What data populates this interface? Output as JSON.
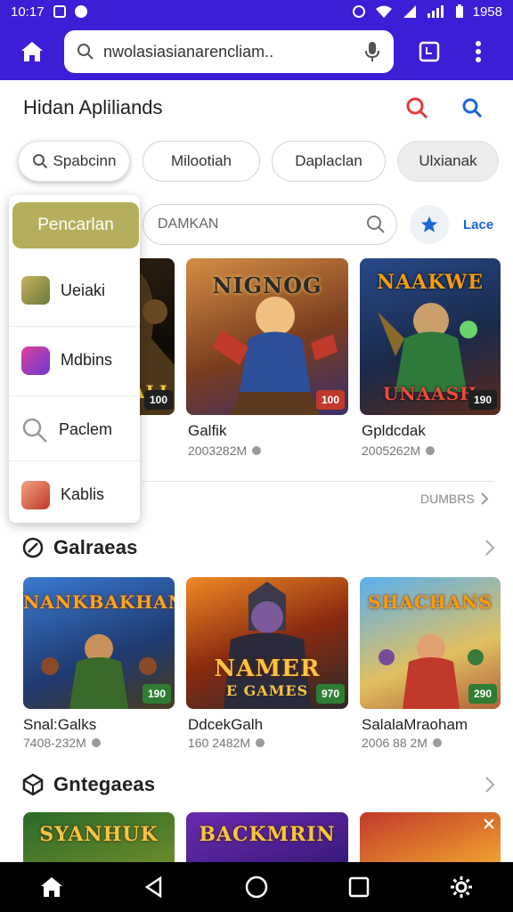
{
  "status_bar": {
    "time": "10:17",
    "battery": "1958"
  },
  "browser": {
    "url": "nwolasiasianarencliam.."
  },
  "header": {
    "title": "Hidan Apliliands"
  },
  "chips": [
    {
      "label": "Spabcinn"
    },
    {
      "label": "Milootiah"
    },
    {
      "label": "Daplaclan"
    },
    {
      "label": "Ulxianak"
    }
  ],
  "search": {
    "placeholder": "DAMKAN",
    "side_label": "Lace"
  },
  "dropdown": {
    "primary": "Pencarlan",
    "items": [
      {
        "label": "Ueiaki"
      },
      {
        "label": "Mdbins"
      },
      {
        "label": "Paclem"
      },
      {
        "label": "Kablis"
      }
    ]
  },
  "row1": [
    {
      "art_title": "ALI",
      "badge": "100"
    },
    {
      "art_title": "NIGNOG",
      "badge": "100",
      "name": "Galfik",
      "meta": "2003282M"
    },
    {
      "art_title": "NAAKWE",
      "art_sub": "UNAASH",
      "badge": "190",
      "name": "Gpldcdak",
      "meta": "2005262M"
    }
  ],
  "more_link": "DUMBRS",
  "section1": {
    "title": "Galraeas"
  },
  "row2": [
    {
      "art_title": "NANKBAKHAN",
      "badge": "190",
      "name": "Snal:Galks",
      "meta": "7408-232M"
    },
    {
      "art_title": "NAMER",
      "art_sub": "E GAMES",
      "badge": "970",
      "name": "DdcekGalh",
      "meta": "160 2482M"
    },
    {
      "art_title": "SHACHANS",
      "badge": "290",
      "name": "SalalaMraoham",
      "meta": "2006 88 2M"
    }
  ],
  "section2": {
    "title": "Gntegaeas"
  },
  "row3": [
    {
      "art_title": "SYANHUK"
    },
    {
      "art_title": "BACKMRIN"
    },
    {
      "art_title": ""
    }
  ],
  "colors": {
    "primary": "#3b1fd6",
    "accent_olive": "#b5ae5d",
    "badge_red": "#c0392b",
    "badge_green": "#2e7d32"
  }
}
